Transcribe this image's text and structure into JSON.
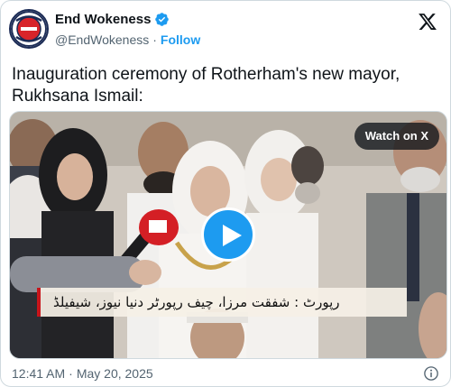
{
  "author": {
    "display_name": "End Wokeness",
    "handle": "@EndWokeness",
    "separator": "·",
    "follow_label": "Follow",
    "verified": true,
    "avatar_text": "EXPOSE THE WOKE"
  },
  "tweet": {
    "text": "Inauguration ceremony of Rotherham's new mayor, Rukhsana Ismail:",
    "time": "12:41 AM",
    "separator": "·",
    "date": "May 20, 2025"
  },
  "media": {
    "type": "video",
    "watch_label": "Watch on X",
    "caption_urdu": "رپورٹ : شفقت مرزا، چیف رپورٹر دنیا نیوز، شیفیلڈ"
  },
  "icons": {
    "verified": "verified-badge-icon",
    "x_logo": "x-logo-icon",
    "play": "play-icon",
    "info": "info-icon"
  },
  "colors": {
    "accent": "#1d9bf0",
    "text": "#0f1419",
    "secondary_text": "#536471",
    "border": "#cfd9de"
  }
}
